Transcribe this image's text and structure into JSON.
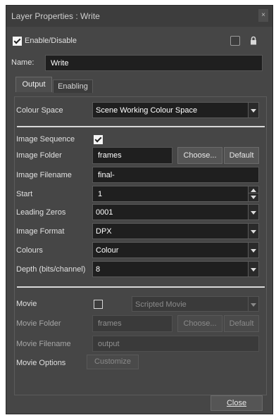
{
  "window": {
    "title": "Layer Properties : Write",
    "close_glyph": "×"
  },
  "header": {
    "enable_label": "Enable/Disable",
    "enable_checked": true,
    "lock_checked": false,
    "name_label": "Name:",
    "name_value": "Write"
  },
  "tabs": [
    {
      "label": "Output",
      "active": true
    },
    {
      "label": "Enabling",
      "active": false
    }
  ],
  "output": {
    "colour_space": {
      "label": "Colour Space",
      "value": "Scene Working Colour Space"
    },
    "image_sequence": {
      "label": "Image Sequence",
      "checked": true
    },
    "image_folder": {
      "label": "Image Folder",
      "value": "frames",
      "choose_label": "Choose...",
      "default_label": "Default"
    },
    "image_filename": {
      "label": "Image Filename",
      "value": "final-"
    },
    "start": {
      "label": "Start",
      "value": "1"
    },
    "leading_zeros": {
      "label": "Leading Zeros",
      "value": "0001"
    },
    "image_format": {
      "label": "Image Format",
      "value": "DPX"
    },
    "colours": {
      "label": "Colours",
      "value": "Colour"
    },
    "depth": {
      "label": "Depth (bits/channel)",
      "value": "8"
    },
    "movie": {
      "label": "Movie",
      "checked": false,
      "type_value": "Scripted Movie"
    },
    "movie_folder": {
      "label": "Movie Folder",
      "value": "frames",
      "choose_label": "Choose...",
      "default_label": "Default"
    },
    "movie_filename": {
      "label": "Movie Filename",
      "value": "output"
    },
    "movie_options": {
      "label": "Movie Options",
      "customize_label": "Customize"
    }
  },
  "footer": {
    "close_label": "Close"
  },
  "icons": {
    "lock": "lock-icon",
    "close": "close-icon",
    "dropdown": "chevron-down-icon"
  }
}
